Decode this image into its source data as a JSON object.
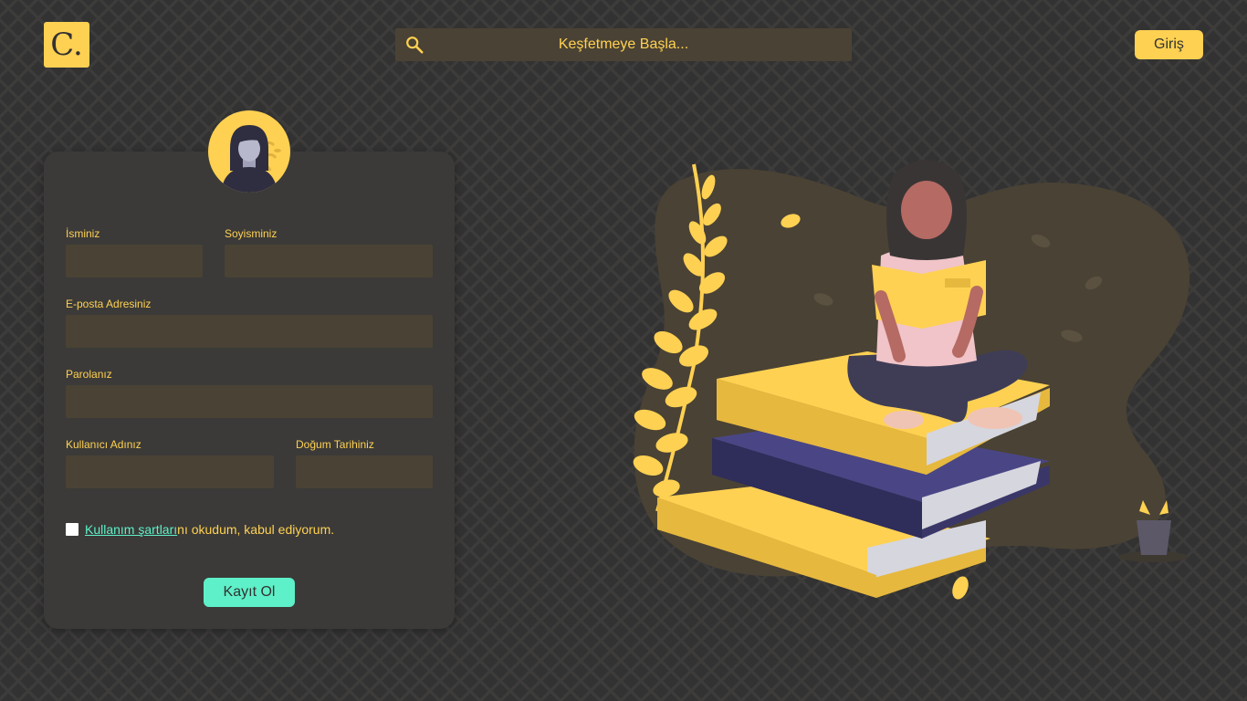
{
  "header": {
    "logo_text": "C.",
    "search": {
      "placeholder": "Keşfetmeye Başla...",
      "icon": "search-icon"
    },
    "login_label": "Giriş"
  },
  "form": {
    "avatar_icon": "user-avatar-icon",
    "first_name": {
      "label": "İsminiz",
      "value": ""
    },
    "last_name": {
      "label": "Soyisminiz",
      "value": ""
    },
    "email": {
      "label": "E-posta Adresiniz",
      "value": ""
    },
    "password": {
      "label": "Parolanız",
      "value": ""
    },
    "username": {
      "label": "Kullanıcı Adınız",
      "value": ""
    },
    "birth_date": {
      "label": "Doğum Tarihiniz",
      "value": ""
    },
    "terms": {
      "link_text": "Kullanım şartları",
      "rest_text": "nı okudum, kabul ediyorum.",
      "checked": false
    },
    "submit_label": "Kayıt Ol"
  },
  "illustration": {
    "icon": "woman-reading-on-books-illustration"
  },
  "colors": {
    "background": "#333232",
    "accent": "#ffd152",
    "secondary_accent": "#5ef0c8",
    "card": "#3b3a38",
    "input": "#4a4234"
  }
}
